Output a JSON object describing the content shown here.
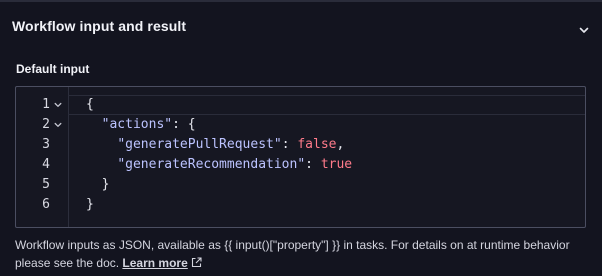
{
  "section": {
    "title": "Workflow input and result",
    "toggle_icon": "chevron-down-icon"
  },
  "input_field": {
    "label": "Default input",
    "lines": [
      {
        "number": "1",
        "foldable": true
      },
      {
        "number": "2",
        "foldable": true
      },
      {
        "number": "3",
        "foldable": false
      },
      {
        "number": "4",
        "foldable": false
      },
      {
        "number": "5",
        "foldable": false
      },
      {
        "number": "6",
        "foldable": false
      }
    ],
    "code": {
      "l1_brace": "{",
      "l2_key": "\"actions\"",
      "l2_rest": ": {",
      "l3_key": "\"generatePullRequest\"",
      "l3_colon": ": ",
      "l3_value": "false",
      "l3_comma": ",",
      "l4_key": "\"generateRecommendation\"",
      "l4_colon": ": ",
      "l4_value": "true",
      "l5_brace": "}",
      "l6_brace": "}"
    }
  },
  "help": {
    "text": "Workflow inputs as JSON, available as {{ input()[\"property\"] }} in tasks. For details on at runtime behavior please see the doc. ",
    "link_label": "Learn more",
    "link_icon": "external-link-icon"
  },
  "colors": {
    "background": "#13141f",
    "editor_border": "#4b4e61",
    "json_key": "#bcc3ff",
    "json_boolean": "#ff7b8b"
  }
}
